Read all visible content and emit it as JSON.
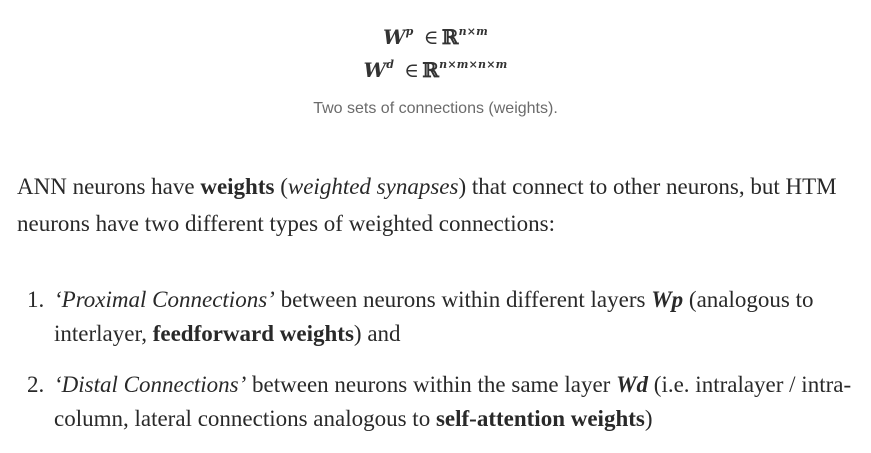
{
  "figure": {
    "eq1": {
      "base": "W",
      "sup": "p",
      "in": "∈",
      "set": "ℝ",
      "dims": "n×m"
    },
    "eq2": {
      "base": "W",
      "sup": "d",
      "in": "∈",
      "set": "ℝ",
      "dims": "n×m×n×m"
    },
    "caption": "Two sets of connections (weights)."
  },
  "paragraph": {
    "t1": "ANN neurons have ",
    "b1": "weights",
    "t2": " (",
    "i1": "weighted synapses",
    "t3": ") that connect to other neurons, but HTM neurons have two different types of weighted connections:"
  },
  "list": [
    {
      "num": "1.",
      "i1": "‘Proximal Connections’",
      "t1": " between neurons within different layers ",
      "bi1": "Wp",
      "t2": " (analogous to interlayer, ",
      "b1": "feedforward weights",
      "t3": ") and"
    },
    {
      "num": "2.",
      "i1": "‘Distal Connections’",
      "t1": " between neurons within the same layer ",
      "bi1": "Wd",
      "t2": " (i.e. intralayer / intra-column, lateral connections analogous to ",
      "b1": "self-attention weights",
      "t3": ")"
    }
  ]
}
